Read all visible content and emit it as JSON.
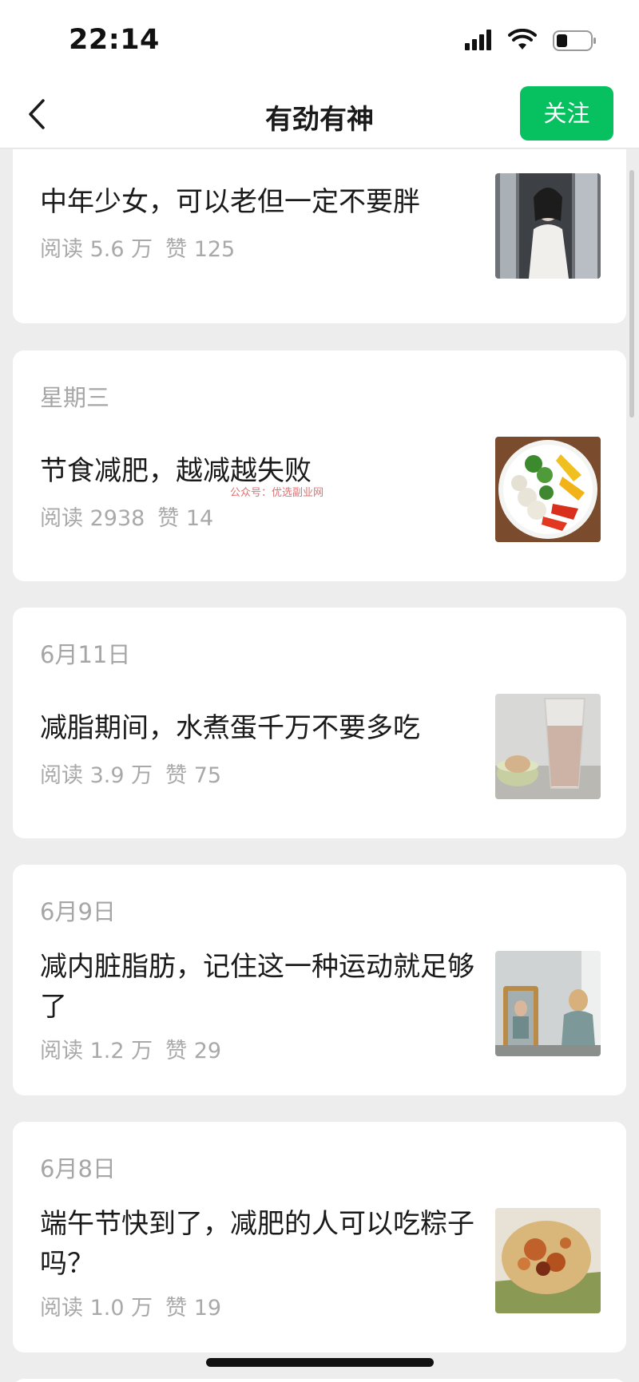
{
  "status": {
    "time": "22:14"
  },
  "nav": {
    "title": "有劲有神",
    "follow_label": "关注"
  },
  "watermark": "公众号：优选副业网",
  "articles": [
    {
      "date": "",
      "title": "中年少女，可以老但一定不要胖",
      "reads": "阅读 5.6 万",
      "likes": "赞 125",
      "thumb": "woman-window-photo"
    },
    {
      "date": "星期三",
      "title": "节食减肥，越减越失败",
      "reads": "阅读 2938",
      "likes": "赞 14",
      "thumb": "vegetable-plate-photo"
    },
    {
      "date": "6月11日",
      "title": "减脂期间，水煮蛋千万不要多吃",
      "reads": "阅读 3.9 万",
      "likes": "赞 75",
      "thumb": "milk-egg-photo"
    },
    {
      "date": "6月9日",
      "title": "减内脏脂肪，记住这一种运动就足够了",
      "reads": "阅读 1.2 万",
      "likes": "赞 29",
      "thumb": "mirror-woman-photo"
    },
    {
      "date": "6月8日",
      "title": "端午节快到了，减肥的人可以吃粽子吗？",
      "reads": "阅读 1.0 万",
      "likes": "赞 19",
      "thumb": "zongzi-photo"
    }
  ],
  "colors": {
    "accent": "#07c160",
    "background": "#ededed",
    "card": "#ffffff",
    "meta_text": "#a9a9a9"
  }
}
